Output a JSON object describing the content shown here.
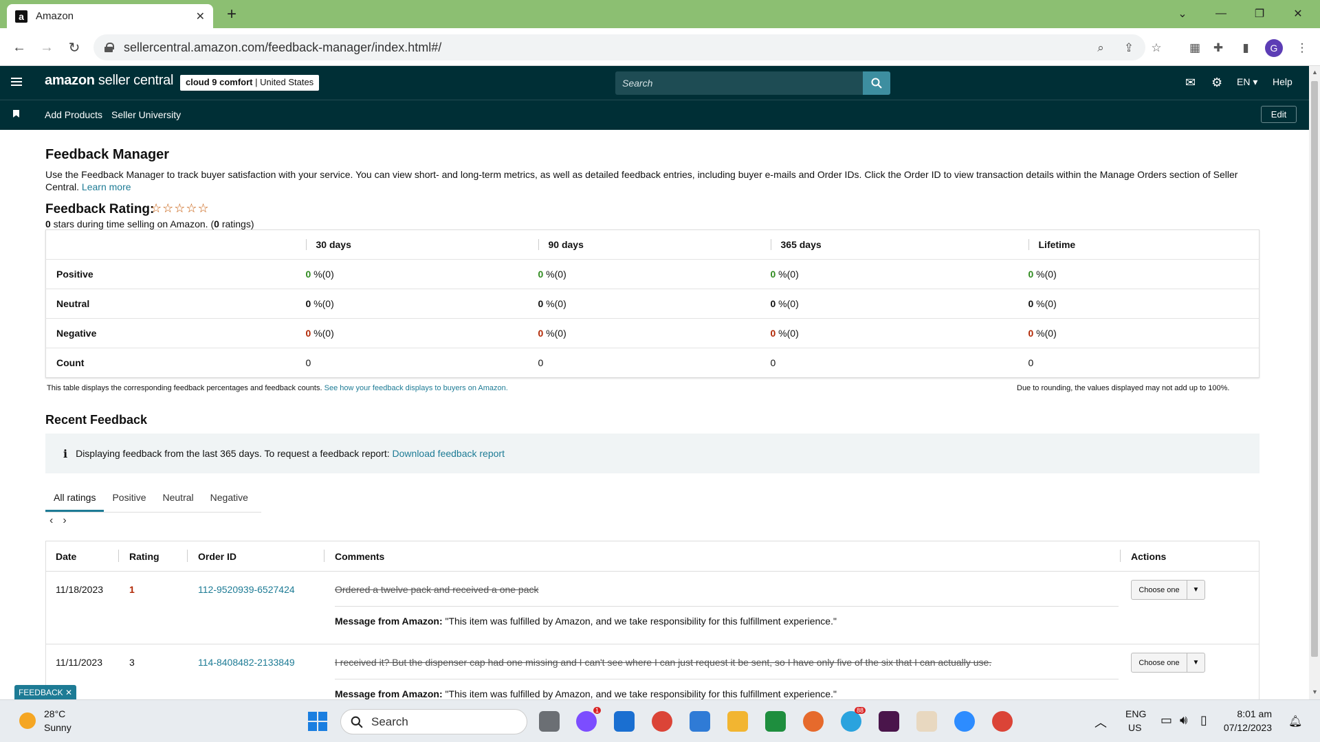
{
  "browser": {
    "tab_title": "Amazon",
    "url": "sellercentral.amazon.com/feedback-manager/index.html#/",
    "profile_initial": "G"
  },
  "header": {
    "logo_bold": "amazon",
    "logo_rest": " seller central",
    "store_name": "cloud 9 comfort",
    "store_region": "United States",
    "search_placeholder": "Search",
    "language": "EN",
    "help": "Help"
  },
  "subnav": {
    "links": [
      "Add Products",
      "Seller University"
    ],
    "edit": "Edit"
  },
  "page": {
    "title": "Feedback Manager",
    "description": "Use the Feedback Manager to track buyer satisfaction with your service. You can view short- and long-term metrics, as well as detailed feedback entries, including buyer e-mails and Order IDs. Click the Order ID to view transaction details within the Manage Orders section of Seller Central.",
    "learn_more": "Learn more",
    "rating_label": "Feedback Rating:",
    "stars_count": 0,
    "rating_summary_stars": "0",
    "rating_summary_mid": " stars during time selling on Amazon. (",
    "rating_summary_count": "0",
    "rating_summary_end": " ratings)"
  },
  "metrics": {
    "columns": [
      "30 days",
      "90 days",
      "365 days",
      "Lifetime"
    ],
    "rows": [
      {
        "label": "Positive",
        "values": [
          "0",
          "0",
          "0",
          "0"
        ],
        "suffix": " %(0)"
      },
      {
        "label": "Neutral",
        "values": [
          "0",
          "0",
          "0",
          "0"
        ],
        "suffix": " %(0)"
      },
      {
        "label": "Negative",
        "values": [
          "0",
          "0",
          "0",
          "0"
        ],
        "suffix": " %(0)"
      },
      {
        "label": "Count",
        "values": [
          "0",
          "0",
          "0",
          "0"
        ],
        "suffix": ""
      }
    ],
    "note_left": "This table displays the corresponding feedback percentages and feedback counts.",
    "note_link": "See how your feedback displays to buyers on Amazon.",
    "note_right": "Due to rounding, the values displayed may not add up to 100%."
  },
  "recent": {
    "title": "Recent Feedback",
    "info_text": "Displaying feedback from the last 365 days. To request a feedback report:",
    "info_link": "Download feedback report",
    "tabs": [
      "All ratings",
      "Positive",
      "Neutral",
      "Negative"
    ],
    "columns": [
      "Date",
      "Rating",
      "Order ID",
      "Comments",
      "Actions"
    ],
    "rows": [
      {
        "date": "11/18/2023",
        "rating": "1",
        "order_id": "112-9520939-6527424",
        "comment": "Ordered a twelve pack and received a one pack",
        "message_label": "Message from Amazon:",
        "message": " \"This item was fulfilled by Amazon, and we take responsibility for this fulfillment experience.\"",
        "action": "Choose one"
      },
      {
        "date": "11/11/2023",
        "rating": "3",
        "order_id": "114-8408482-2133849",
        "comment": "I received it? But the dispenser cap had one missing and I can't see where I can just request it be sent, so I have only five of the six that I can actually use.",
        "message_label": "Message from Amazon:",
        "message": " \"This item was fulfilled by Amazon, and we take responsibility for this fulfillment experience.\"",
        "action": "Choose one"
      }
    ],
    "feedback_tab": "FEEDBACK"
  },
  "taskbar": {
    "temperature": "28°C",
    "condition": "Sunny",
    "search": "Search",
    "lang": "ENG",
    "region": "US",
    "time": "8:01 am",
    "date": "07/12/2023",
    "messenger_badge": "1",
    "telegram_badge": "88"
  },
  "colors": {
    "header_bg": "#002f36",
    "link": "#1d7b95",
    "positive": "#2f8a1f",
    "negative": "#b12704",
    "tab_strip": "#8cbf72"
  }
}
